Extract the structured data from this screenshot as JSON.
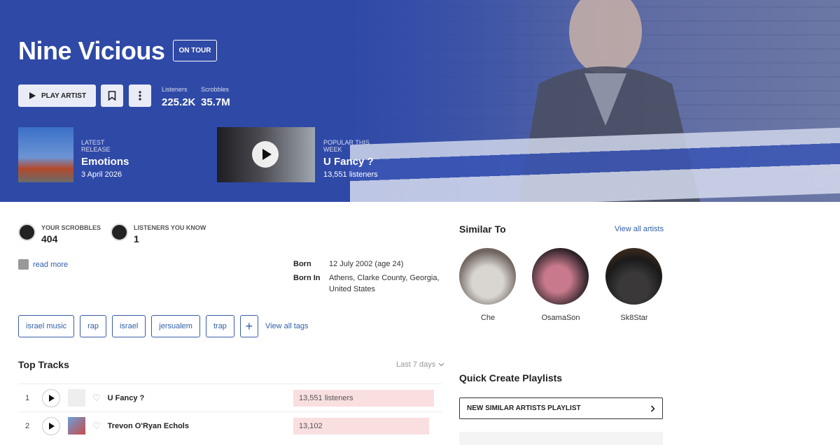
{
  "artist": {
    "name": "Nine Vicious",
    "badge": "ON TOUR",
    "play_label": "PLAY ARTIST",
    "stats": {
      "listeners_label": "Listeners",
      "listeners_value": "225.2K",
      "scrobbles_label": "Scrobbles",
      "scrobbles_value": "35.7M"
    },
    "latest_release": {
      "kicker": "LATEST RELEASE",
      "title": "Emotions",
      "date": "3 April 2026"
    },
    "popular": {
      "kicker": "POPULAR THIS WEEK",
      "title": "U Fancy ?",
      "listeners": "13,551 listeners"
    }
  },
  "user": {
    "your_scrobbles_label": "YOUR SCROBBLES",
    "your_scrobbles_value": "404",
    "listeners_know_label": "LISTENERS YOU KNOW",
    "listeners_know_value": "1",
    "read_more": "read more"
  },
  "facts": [
    {
      "key": "Born",
      "value": "12 July 2002 (age 24)"
    },
    {
      "key": "Born In",
      "value": "Athens, Clarke County, Georgia, United States"
    }
  ],
  "tags": [
    "israel music",
    "rap",
    "israel",
    "jersualem",
    "trap"
  ],
  "tags_add": "+",
  "view_all_tags": "View all tags",
  "top_tracks": {
    "title": "Top Tracks",
    "period": "Last 7 days",
    "rows": [
      {
        "num": "1",
        "name": "U Fancy ?",
        "listeners": "13,551 listeners",
        "bar": 1.0
      },
      {
        "num": "2",
        "name": "Trevon O'Ryan Echols",
        "listeners": "13,102",
        "bar": 0.967
      }
    ]
  },
  "similar": {
    "title": "Similar To",
    "view_all": "View all artists",
    "artists": [
      "Che",
      "OsamaSon",
      "Sk8Star"
    ]
  },
  "quick_create": {
    "title": "Quick Create Playlists",
    "new_similar": "NEW SIMILAR ARTISTS PLAYLIST"
  },
  "colors": {
    "hero": "#2f49a7",
    "link": "#2f5fa8",
    "bar": "#fadfe0"
  }
}
